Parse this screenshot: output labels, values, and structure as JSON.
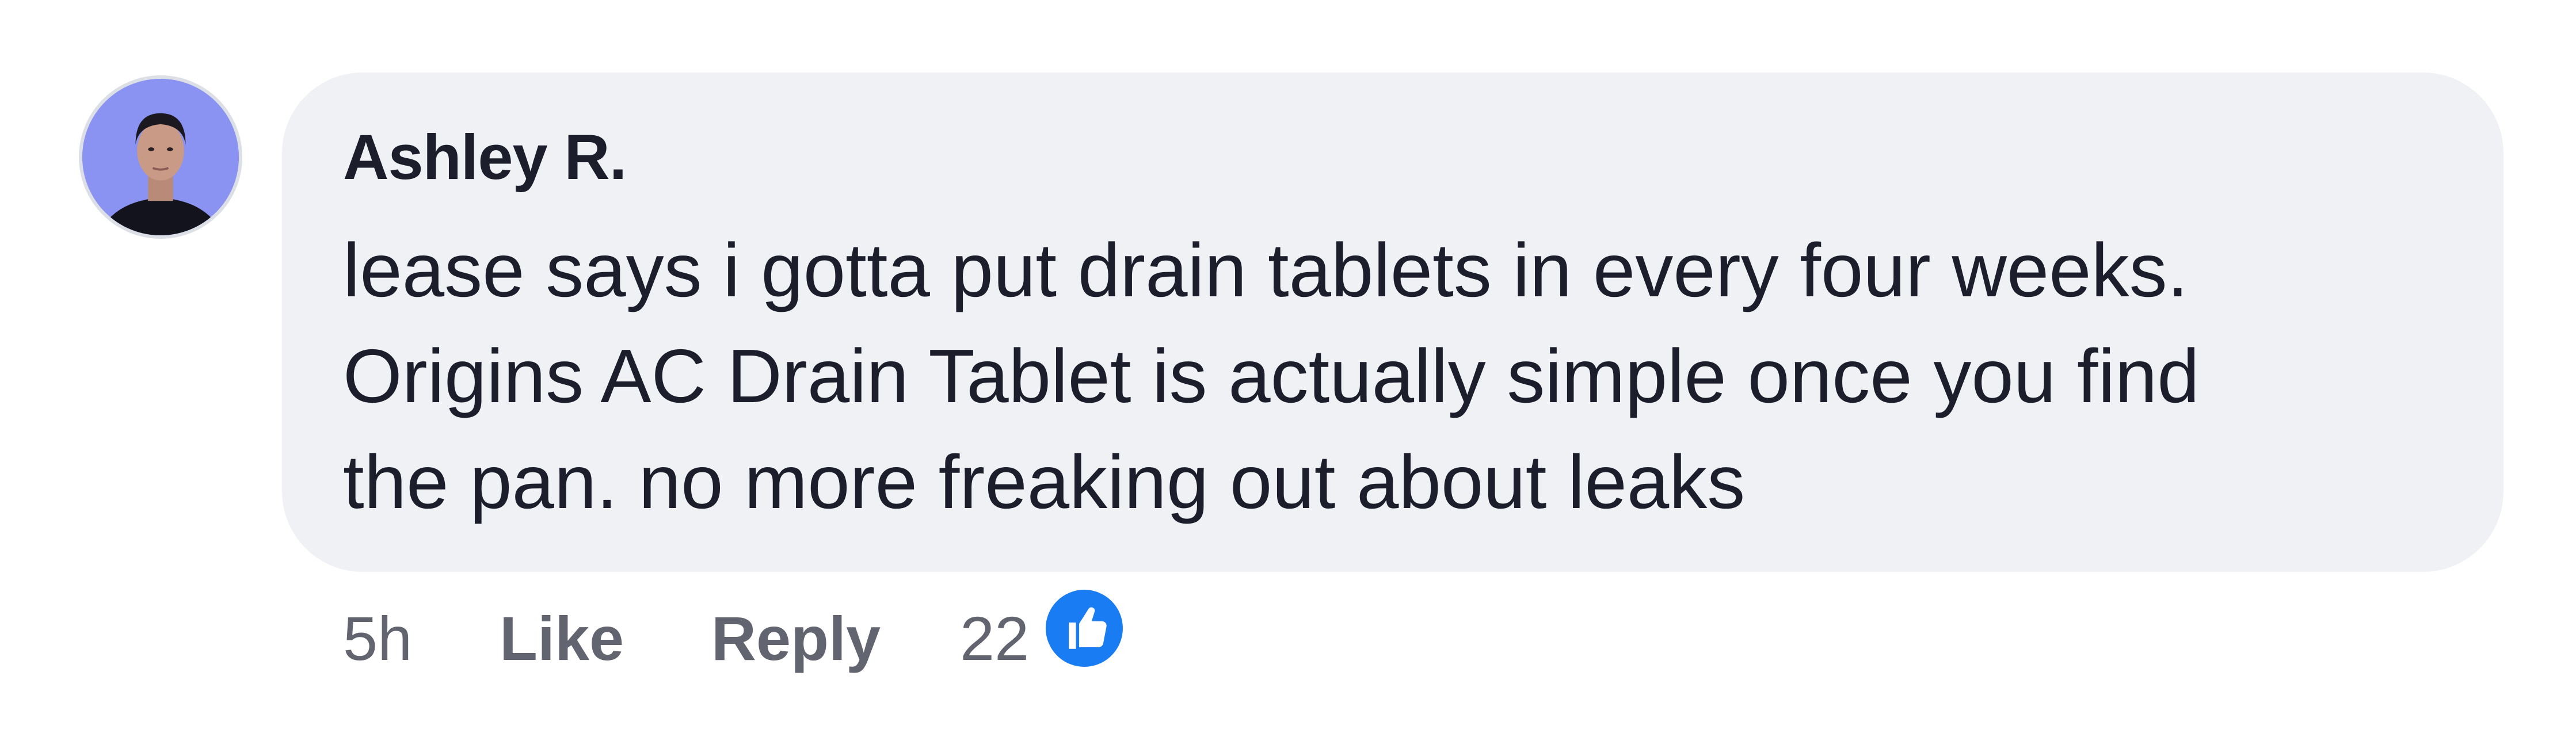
{
  "comment": {
    "author": "Ashley R.",
    "text": "lease says i gotta put drain tablets in every four weeks.\nOrigins AC Drain Tablet is actually simple once you find\nthe pan. no more freaking out about leaks",
    "avatar_icon": "user-avatar-photo"
  },
  "actions": {
    "time": "5h",
    "like_label": "Like",
    "reply_label": "Reply",
    "reaction_count": "22",
    "reaction_icon": "thumbs-up-icon"
  },
  "colors": {
    "bubble": "#f0f1f5",
    "text": "#1c1e2b",
    "meta": "#62656f",
    "like_accent": "#1a7cf2"
  }
}
